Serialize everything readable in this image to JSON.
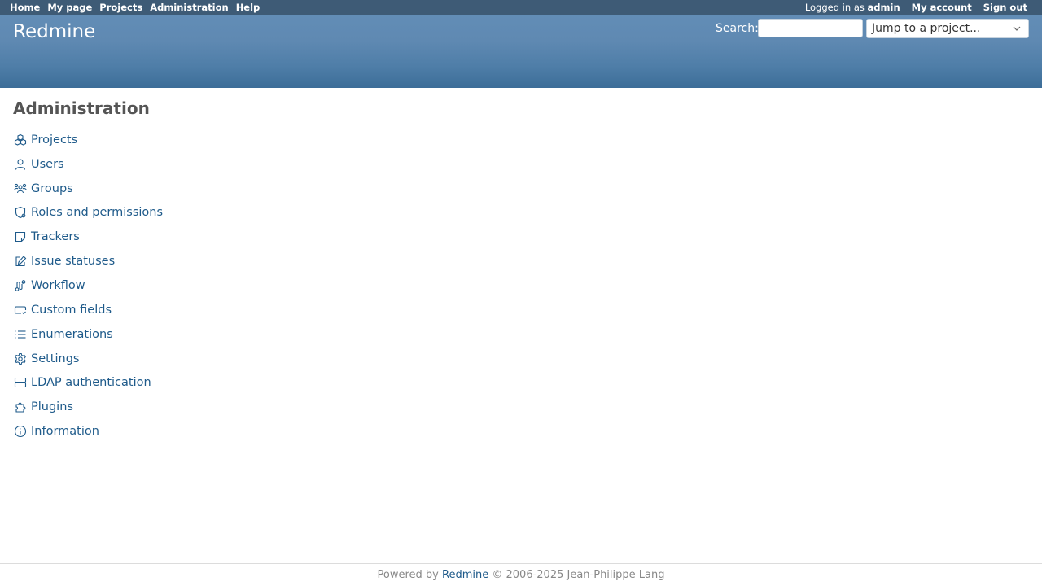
{
  "top_menu": {
    "home": "Home",
    "my_page": "My page",
    "projects": "Projects",
    "administration": "Administration",
    "help": "Help",
    "logged_in_as": "Logged in as",
    "username": "admin",
    "my_account": "My account",
    "sign_out": "Sign out"
  },
  "header": {
    "title": "Redmine",
    "search_label": "Search:",
    "search_value": "",
    "jump_to_project": "Jump to a project..."
  },
  "main": {
    "title": "Administration",
    "menu": [
      {
        "label": "Projects",
        "icon": "projects-icon"
      },
      {
        "label": "Users",
        "icon": "user-icon"
      },
      {
        "label": "Groups",
        "icon": "groups-icon"
      },
      {
        "label": "Roles and permissions",
        "icon": "roles-icon"
      },
      {
        "label": "Trackers",
        "icon": "trackers-icon"
      },
      {
        "label": "Issue statuses",
        "icon": "edit-icon"
      },
      {
        "label": "Workflow",
        "icon": "workflow-icon"
      },
      {
        "label": "Custom fields",
        "icon": "custom-fields-icon"
      },
      {
        "label": "Enumerations",
        "icon": "list-icon"
      },
      {
        "label": "Settings",
        "icon": "gear-icon"
      },
      {
        "label": "LDAP authentication",
        "icon": "server-icon"
      },
      {
        "label": "Plugins",
        "icon": "puzzle-icon"
      },
      {
        "label": "Information",
        "icon": "info-icon"
      }
    ]
  },
  "footer": {
    "powered_by": "Powered by",
    "redmine_link": "Redmine",
    "copyright": "© 2006-2025 Jean-Philippe Lang"
  },
  "colors": {
    "top_menu_bg": "#3e5b76",
    "header_gradient_top": "#628db6",
    "header_gradient_bottom": "#3c6d98",
    "link": "#1e5a8a",
    "title": "#555555"
  }
}
